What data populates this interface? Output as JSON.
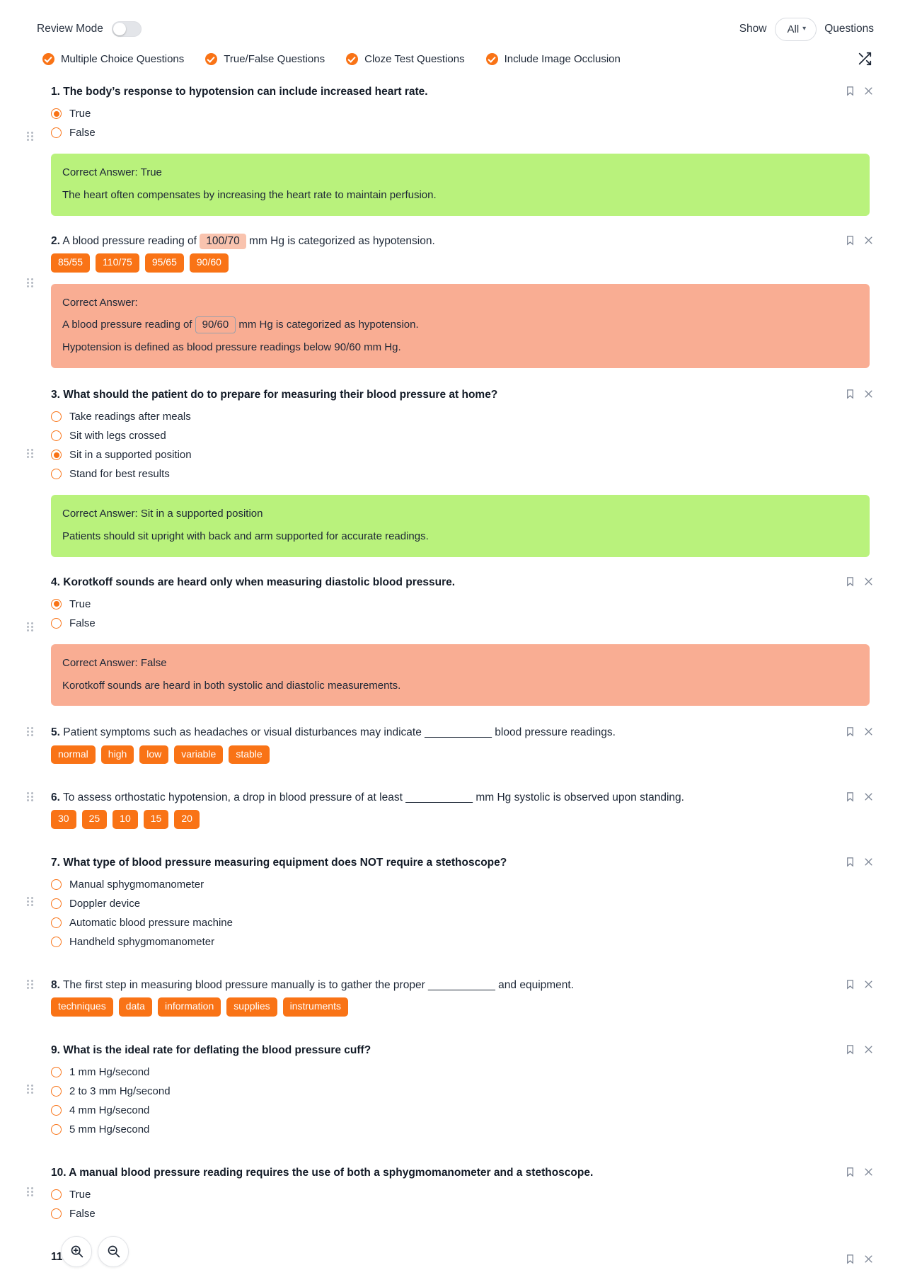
{
  "header": {
    "review_mode_label": "Review Mode",
    "review_mode_on": false,
    "show_label": "Show",
    "show_value": "All",
    "questions_label": "Questions"
  },
  "filters": [
    {
      "label": "Multiple Choice Questions",
      "checked": true
    },
    {
      "label": "True/False Questions",
      "checked": true
    },
    {
      "label": "Cloze Test Questions",
      "checked": true
    },
    {
      "label": "Include Image Occlusion",
      "checked": true
    }
  ],
  "icons": {
    "shuffle": "shuffle-icon",
    "bookmark": "bookmark-icon",
    "close": "close-icon",
    "zoom_in": "zoom-in-icon",
    "zoom_out": "zoom-out-icon"
  },
  "questions": [
    {
      "num": "1.",
      "type": "truefalse",
      "text": "The body’s response to hypotension can include increased heart rate.",
      "options": [
        {
          "label": "True",
          "selected": true
        },
        {
          "label": "False",
          "selected": false
        }
      ],
      "answer": {
        "state": "correct",
        "lines": [
          "Correct Answer: True",
          "The heart often compensates by increasing the heart rate to maintain perfusion."
        ]
      }
    },
    {
      "num": "2.",
      "type": "cloze",
      "text_before": "A blood pressure reading of ",
      "blank_value": "100/70",
      "text_after": " mm Hg is categorized as hypotension.",
      "chips": [
        "85/55",
        "110/75",
        "95/65",
        "90/60"
      ],
      "answer": {
        "state": "wrong",
        "heading": "Correct Answer:",
        "cloze_before": "A blood pressure reading of ",
        "cloze_value": "90/60",
        "cloze_after": " mm Hg is categorized as hypotension.",
        "explanation": "Hypotension is defined as blood pressure readings below 90/60 mm Hg."
      }
    },
    {
      "num": "3.",
      "type": "mcq",
      "text": "What should the patient do to prepare for measuring their blood pressure at home?",
      "options": [
        {
          "label": "Take readings after meals",
          "selected": false
        },
        {
          "label": "Sit with legs crossed",
          "selected": false
        },
        {
          "label": "Sit in a supported position",
          "selected": true
        },
        {
          "label": "Stand for best results",
          "selected": false
        }
      ],
      "answer": {
        "state": "correct",
        "lines": [
          "Correct Answer: Sit in a supported position",
          "Patients should sit upright with back and arm supported for accurate readings."
        ]
      }
    },
    {
      "num": "4.",
      "type": "truefalse",
      "text": "Korotkoff sounds are heard only when measuring diastolic blood pressure.",
      "options": [
        {
          "label": "True",
          "selected": true
        },
        {
          "label": "False",
          "selected": false
        }
      ],
      "answer": {
        "state": "wrong",
        "lines": [
          "Correct Answer: False",
          "Korotkoff sounds are heard in both systolic and diastolic measurements."
        ]
      }
    },
    {
      "num": "5.",
      "type": "cloze",
      "text_before": "Patient symptoms such as headaches or visual disturbances may indicate ",
      "blank_value": "___________",
      "text_after": " blood pressure readings.",
      "chips": [
        "normal",
        "high",
        "low",
        "variable",
        "stable"
      ]
    },
    {
      "num": "6.",
      "type": "cloze",
      "text_before": "To assess orthostatic hypotension, a drop in blood pressure of at least ",
      "blank_value": "___________",
      "text_after": " mm Hg systolic is observed upon standing.",
      "chips": [
        "30",
        "25",
        "10",
        "15",
        "20"
      ]
    },
    {
      "num": "7.",
      "type": "mcq",
      "text": "What type of blood pressure measuring equipment does NOT require a stethoscope?",
      "options": [
        {
          "label": "Manual sphygmomanometer",
          "selected": false
        },
        {
          "label": "Doppler device",
          "selected": false
        },
        {
          "label": "Automatic blood pressure machine",
          "selected": false
        },
        {
          "label": "Handheld sphygmomanometer",
          "selected": false
        }
      ]
    },
    {
      "num": "8.",
      "type": "cloze",
      "text_before": "The first step in measuring blood pressure manually is to gather the proper ",
      "blank_value": "___________",
      "text_after": " and equipment.",
      "chips": [
        "techniques",
        "data",
        "information",
        "supplies",
        "instruments"
      ]
    },
    {
      "num": "9.",
      "type": "mcq",
      "text": "What is the ideal rate for deflating the blood pressure cuff?",
      "options": [
        {
          "label": "1 mm Hg/second",
          "selected": false
        },
        {
          "label": "2 to 3 mm Hg/second",
          "selected": false
        },
        {
          "label": "4 mm Hg/second",
          "selected": false
        },
        {
          "label": "5 mm Hg/second",
          "selected": false
        }
      ]
    },
    {
      "num": "10.",
      "type": "truefalse",
      "text": "A manual blood pressure reading requires the use of both a sphygmomanometer and a stethoscope.",
      "options": [
        {
          "label": "True",
          "selected": false
        },
        {
          "label": "False",
          "selected": false
        }
      ]
    },
    {
      "num": "11.",
      "type": "partial",
      "text": ""
    }
  ]
}
